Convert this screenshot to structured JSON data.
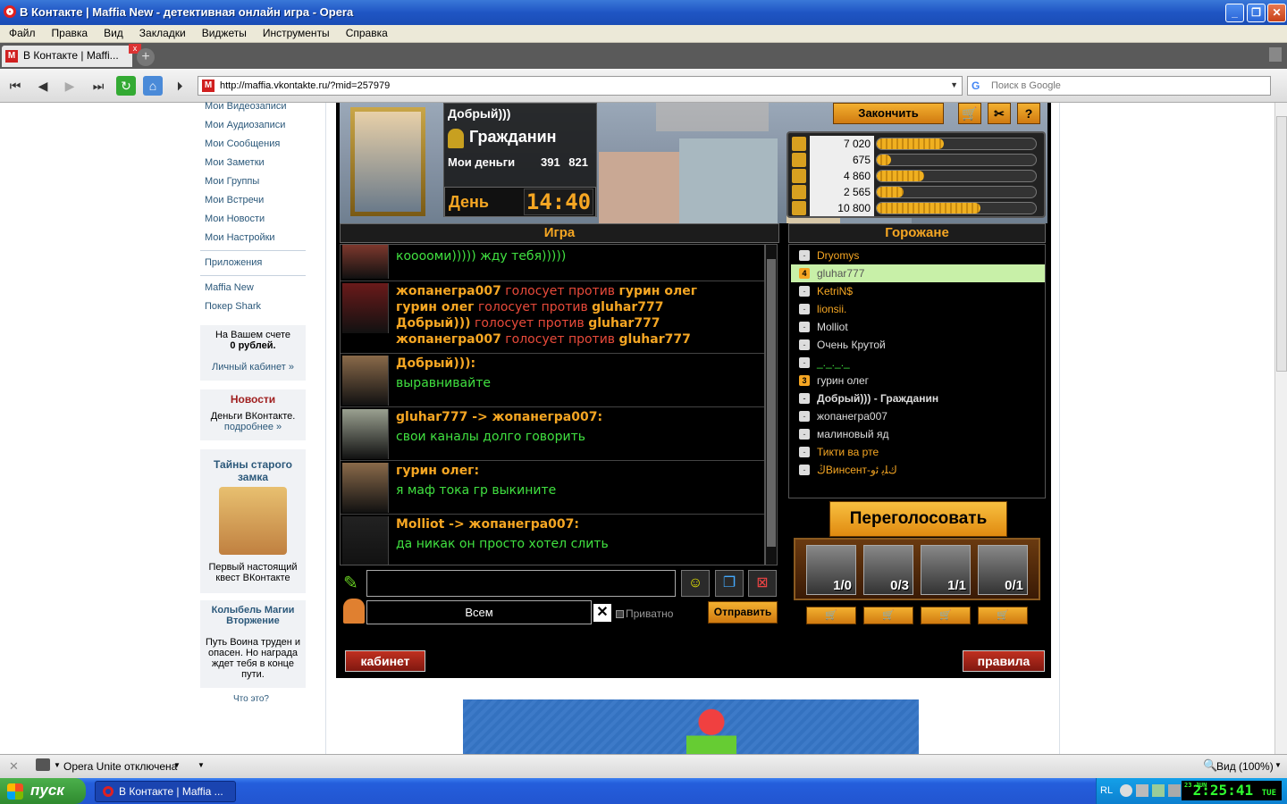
{
  "window": {
    "title": "В Контакте | Maffia New - детективная онлайн игра - Opera"
  },
  "menu": [
    "Файл",
    "Правка",
    "Вид",
    "Закладки",
    "Виджеты",
    "Инструменты",
    "Справка"
  ],
  "tab": {
    "label": "В Контакте | Maffi..."
  },
  "address": {
    "url": "http://maffia.vkontakte.ru/?mid=257979",
    "search_placeholder": "Поиск в Google"
  },
  "sidebar": {
    "links": [
      "Мои Видеозаписи",
      "Мои Аудиозаписи",
      "Мои Сообщения",
      "Мои Заметки",
      "Мои Группы",
      "Мои Встречи",
      "Мои Новости",
      "Мои Настройки"
    ],
    "apps_link": "Приложения",
    "app_links": [
      "Maffia New",
      "Покер Shark"
    ],
    "balance": {
      "line1": "На Вашем счете",
      "line2": "0 рублей.",
      "link": "Личный кабинет »"
    },
    "news": {
      "title": "Новости",
      "text": "Деньги ВКонтакте.",
      "link": "подробнее »"
    },
    "ad1": {
      "title": "Тайны старого замка",
      "text": "Первый настоящий квест ВКонтакте"
    },
    "ad2": {
      "title": "Колыбель Магии Вторжение",
      "text": "Путь Воина труден и опасен. Но награда ждет тебя в конце пути.",
      "link": "Что это?"
    }
  },
  "game": {
    "player": {
      "name": "Добрый)))",
      "role": "Гражданин",
      "money_label": "Мои деньги",
      "money": "391 821",
      "day_label": "День",
      "time": "14:40"
    },
    "finish_label": "Закончить",
    "stats": [
      {
        "icon": "clock-icon",
        "value": "7 020",
        "level": 0.42
      },
      {
        "icon": "wand-icon",
        "value": "675",
        "level": 0.09
      },
      {
        "icon": "money-bag-icon",
        "value": "4 860",
        "level": 0.3
      },
      {
        "icon": "key-icon",
        "value": "2 565",
        "level": 0.17
      },
      {
        "icon": "house-icon",
        "value": "10 800",
        "level": 0.65
      }
    ],
    "chat_title": "Игра",
    "citizens_title": "Горожане",
    "messages": [
      {
        "lines": [
          [
            {
              "t": "кооооми))))) жду тебя)))))",
              "c": "g"
            }
          ]
        ]
      },
      {
        "lines": [
          [
            {
              "t": "жопанегра007",
              "c": "o"
            },
            {
              "t": " голосует против ",
              "c": "r"
            },
            {
              "t": "гурин олег",
              "c": "o"
            }
          ],
          [
            {
              "t": "гурин олег",
              "c": "o"
            },
            {
              "t": " голосует против ",
              "c": "r"
            },
            {
              "t": "gluhar777",
              "c": "o"
            }
          ],
          [
            {
              "t": "Добрый)))",
              "c": "o"
            },
            {
              "t": " голосует против ",
              "c": "r"
            },
            {
              "t": "gluhar777",
              "c": "o"
            }
          ],
          [
            {
              "t": "жопанегра007",
              "c": "o"
            },
            {
              "t": " голосует против ",
              "c": "r"
            },
            {
              "t": "gluhar777",
              "c": "o"
            }
          ]
        ]
      },
      {
        "lines": [
          [
            {
              "t": "Добрый))):",
              "c": "o"
            }
          ],
          [
            {
              "t": "выравнивайте",
              "c": "g"
            }
          ]
        ]
      },
      {
        "lines": [
          [
            {
              "t": "gluhar777 -> жопанегра007:",
              "c": "o"
            }
          ],
          [
            {
              "t": "свои каналы долго говорить",
              "c": "g"
            }
          ]
        ]
      },
      {
        "lines": [
          [
            {
              "t": "гурин олег:",
              "c": "o"
            }
          ],
          [
            {
              "t": "я маф тока гр выкините",
              "c": "g"
            }
          ]
        ]
      },
      {
        "lines": [
          [
            {
              "t": "Molliot -> жопанегра007:",
              "c": "o"
            }
          ],
          [
            {
              "t": "да никак он просто хотел слить",
              "c": "g"
            }
          ]
        ]
      }
    ],
    "citizens": [
      {
        "name": "Dryomys",
        "badge": "-",
        "color": "#f5a623"
      },
      {
        "name": "gluhar777",
        "badge": "4",
        "color": "#555",
        "selected": true
      },
      {
        "name": "KetriN$",
        "badge": "-",
        "color": "#f5a623"
      },
      {
        "name": "lionsii.",
        "badge": "-",
        "color": "#f5a623"
      },
      {
        "name": "Molliot",
        "badge": "-",
        "color": "#ddd"
      },
      {
        "name": "Очень Крутой",
        "badge": "-",
        "color": "#ddd"
      },
      {
        "name": "_._._._",
        "badge": "-",
        "color": "#40e040"
      },
      {
        "name": "гурин олег",
        "badge": "3",
        "color": "#ddd"
      },
      {
        "name": "Добрый))) - Гражданин",
        "badge": "-",
        "color": "#ddd",
        "bold": true
      },
      {
        "name": "жопанегра007",
        "badge": "-",
        "color": "#ddd"
      },
      {
        "name": "малиновый яд",
        "badge": "-",
        "color": "#ddd"
      },
      {
        "name": "Тикти ва рте",
        "badge": "-",
        "color": "#f5a623"
      },
      {
        "name": "ڭВинсент-ﻙﻠﻳ ﺋﻭ",
        "badge": "-",
        "color": "#f5a623"
      }
    ],
    "to_label": "Всем",
    "private_label": "Приватно",
    "send_label": "Отправить",
    "revote_label": "Переголосовать",
    "items": [
      "1/0",
      "0/3",
      "1/1",
      "0/1"
    ],
    "cabinet_label": "кабинет",
    "rules_label": "правила"
  },
  "statusbar": {
    "unite": "Opera Unite отключена",
    "zoom": "Вид (100%)"
  },
  "taskbar": {
    "start": "пуск",
    "task": "В Контакте | Maffia ...",
    "lang": "RL",
    "date": "23 JUN",
    "time": "2:25:41",
    "day": "TUE"
  }
}
